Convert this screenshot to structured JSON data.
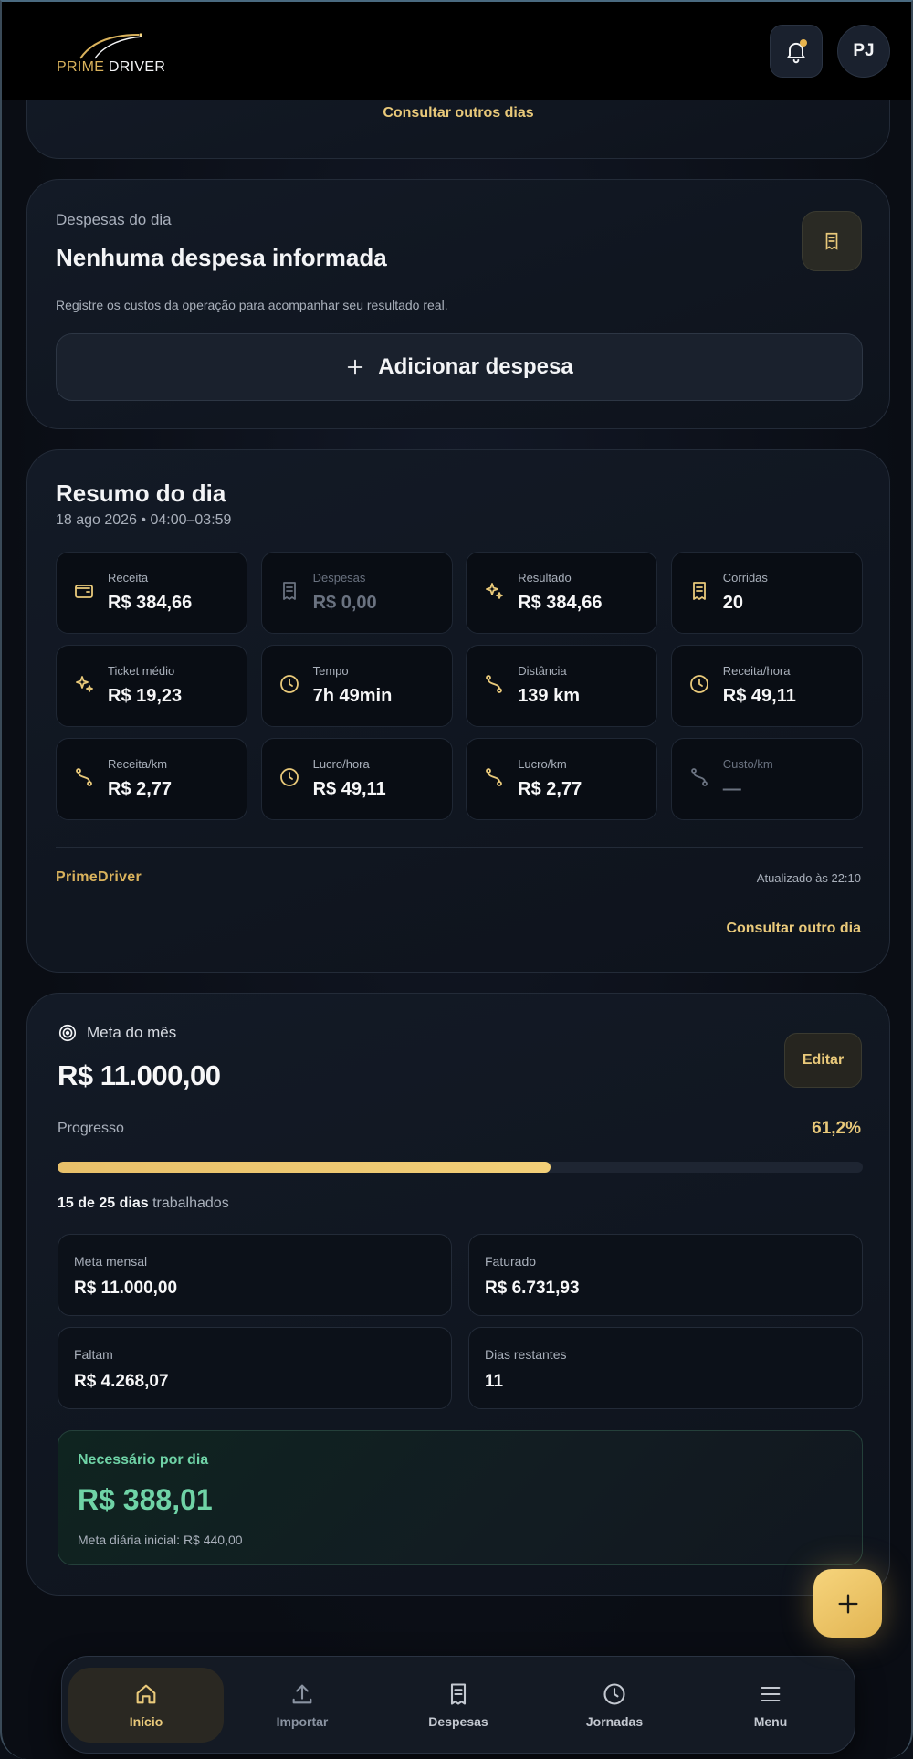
{
  "header": {
    "brand_prime": "PRIME",
    "brand_driver": "DRIVER",
    "avatar_initials": "PJ",
    "notification_dot": true
  },
  "top_card": {
    "link": "Consultar outros dias"
  },
  "expenses_card": {
    "label": "Despesas do dia",
    "title": "Nenhuma despesa informada",
    "description": "Registre os custos da operação para acompanhar seu resultado real.",
    "add_button": "Adicionar despesa"
  },
  "summary_card": {
    "title": "Resumo do dia",
    "subtitle": "18 ago 2026 • 04:00–03:59",
    "tiles": [
      {
        "icon": "wallet-icon",
        "label": "Receita",
        "value": "R$ 384,66",
        "muted": false
      },
      {
        "icon": "receipt-icon",
        "label": "Despesas",
        "value": "R$ 0,00",
        "muted": true
      },
      {
        "icon": "sparkles-icon",
        "label": "Resultado",
        "value": "R$ 384,66",
        "muted": false
      },
      {
        "icon": "receipt-icon",
        "label": "Corridas",
        "value": "20",
        "muted": false
      },
      {
        "icon": "sparkles-icon",
        "label": "Ticket médio",
        "value": "R$ 19,23",
        "muted": false
      },
      {
        "icon": "clock-icon",
        "label": "Tempo",
        "value": "7h 49min",
        "muted": false
      },
      {
        "icon": "route-icon",
        "label": "Distância",
        "value": "139 km",
        "muted": false
      },
      {
        "icon": "clock-icon",
        "label": "Receita/hora",
        "value": "R$ 49,11",
        "muted": false
      },
      {
        "icon": "route-icon",
        "label": "Receita/km",
        "value": "R$ 2,77",
        "muted": false
      },
      {
        "icon": "clock-icon",
        "label": "Lucro/hora",
        "value": "R$ 49,11",
        "muted": false
      },
      {
        "icon": "route-icon",
        "label": "Lucro/km",
        "value": "R$ 2,77",
        "muted": false
      },
      {
        "icon": "route-icon",
        "label": "Custo/km",
        "value": "—",
        "muted": true
      }
    ],
    "brand": "PrimeDriver",
    "updated": "Atualizado às 22:10",
    "link": "Consultar outro dia"
  },
  "goal_card": {
    "label": "Meta do mês",
    "amount": "R$ 11.000,00",
    "edit_button": "Editar",
    "progress_label": "Progresso",
    "progress_text": "61,2%",
    "progress_value": 61.2,
    "days_bold": "15 de 25 dias",
    "days_rest": "trabalhados",
    "stats": [
      {
        "label": "Meta mensal",
        "value": "R$ 11.000,00"
      },
      {
        "label": "Faturado",
        "value": "R$ 6.731,93"
      },
      {
        "label": "Faltam",
        "value": "R$ 4.268,07"
      },
      {
        "label": "Dias restantes",
        "value": "11"
      }
    ],
    "needed": {
      "label": "Necessário por dia",
      "value": "R$ 388,01",
      "sub": "Meta diária inicial: R$ 440,00"
    }
  },
  "nav": [
    {
      "label": "Início",
      "icon": "home-icon",
      "active": true
    },
    {
      "label": "Importar",
      "icon": "upload-icon",
      "active": false
    },
    {
      "label": "Despesas",
      "icon": "receipt-icon",
      "active": false
    },
    {
      "label": "Jornadas",
      "icon": "clock-icon",
      "active": false
    },
    {
      "label": "Menu",
      "icon": "menu-icon",
      "active": false
    }
  ],
  "colors": {
    "gold": "#e9c97a",
    "green": "#6fd3a6",
    "background": "#0b0f17"
  }
}
